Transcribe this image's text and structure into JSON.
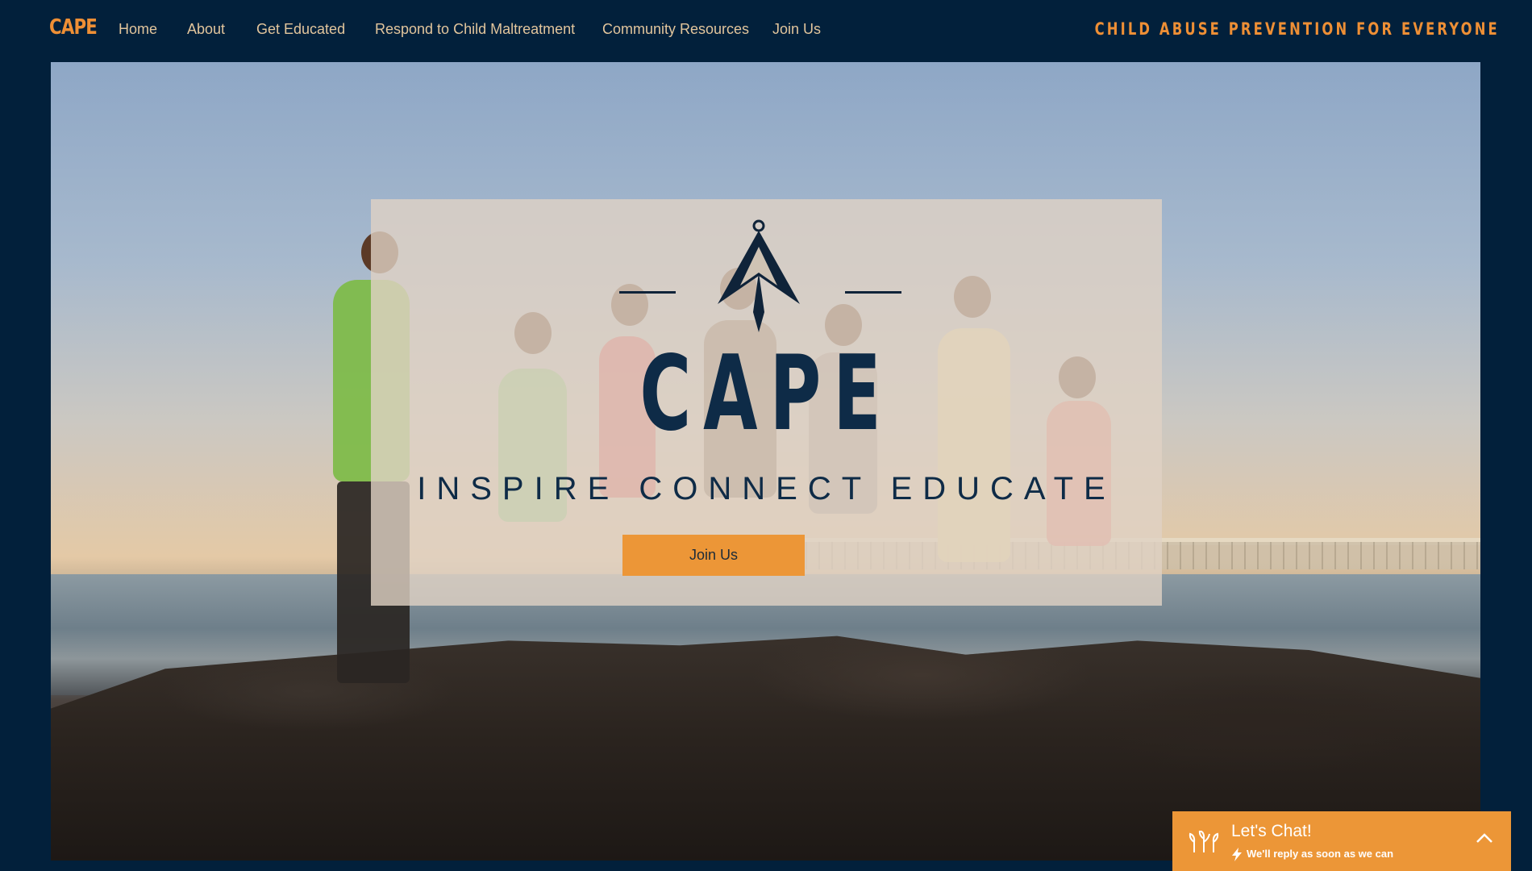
{
  "header": {
    "brand": "CAPE",
    "nav": [
      {
        "label": "Home"
      },
      {
        "label": "About"
      },
      {
        "label": "Get Educated"
      },
      {
        "label": "Respond to Child Maltreatment"
      },
      {
        "label": "Community Resources"
      },
      {
        "label": "Join Us"
      }
    ],
    "tagline": "CHILD ABUSE PREVENTION FOR EVERYONE"
  },
  "hero": {
    "title": "CAPE",
    "subtitle": "INSPIRE CONNECT EDUCATE",
    "cta_label": "Join Us"
  },
  "chat": {
    "title": "Let's Chat!",
    "subtitle": "We'll reply as soon as we can"
  },
  "colors": {
    "background": "#02203b",
    "accent": "#ee8f35",
    "nav_text": "#e2c59c",
    "title_text": "#0e2b47",
    "button": "#ec9637"
  },
  "icons": {
    "brand_mark": "compass-arrow-icon",
    "chat_logo": "plant-sprouts-icon",
    "chat_bolt": "lightning-bolt-icon",
    "chat_toggle": "chevron-up-icon"
  }
}
